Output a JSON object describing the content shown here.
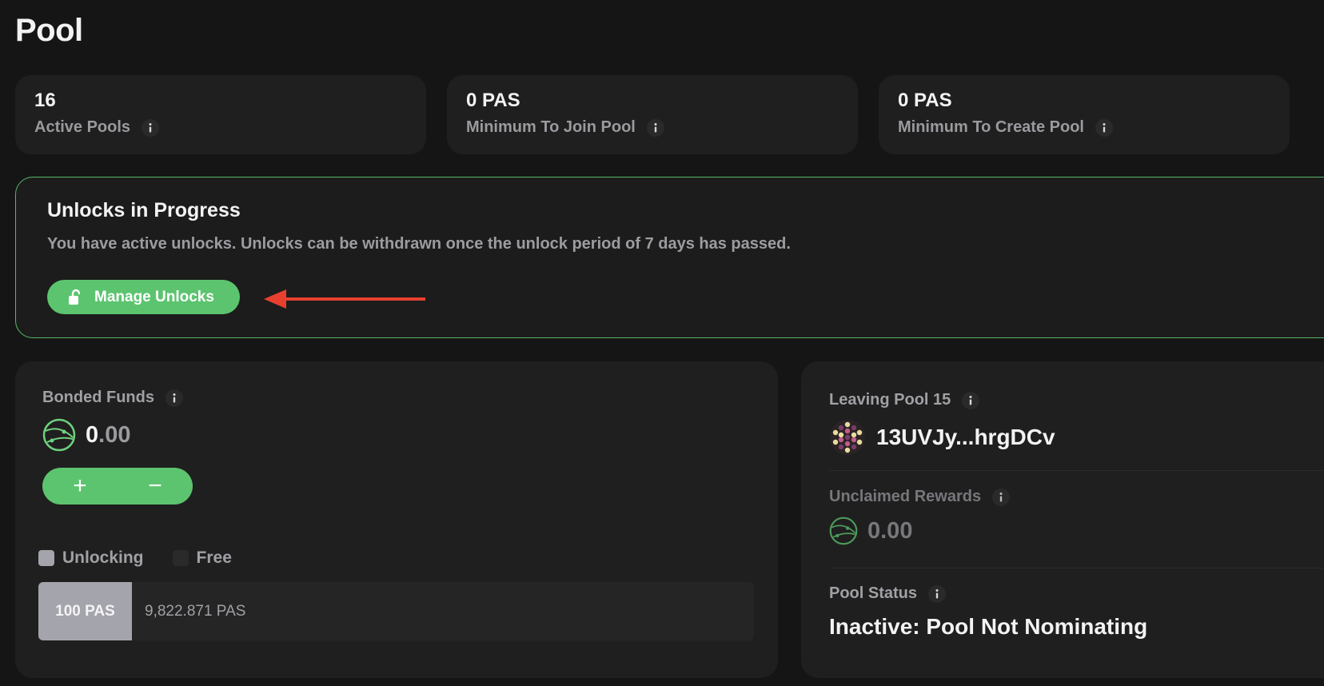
{
  "page": {
    "title": "Pool"
  },
  "stats": [
    {
      "value": "16",
      "label": "Active Pools"
    },
    {
      "value": "0 PAS",
      "label": "Minimum To Join Pool"
    },
    {
      "value": "0 PAS",
      "label": "Minimum To Create Pool"
    }
  ],
  "unlocks": {
    "title": "Unlocks in Progress",
    "description": "You have active unlocks. Unlocks can be withdrawn once the unlock period of 7 days has passed.",
    "button_label": "Manage Unlocks"
  },
  "bonded": {
    "label": "Bonded Funds",
    "amount_int": "0",
    "amount_dec": ".00",
    "add_symbol": "+",
    "remove_symbol": "−",
    "legend": [
      {
        "label": "Unlocking",
        "color": "#a4a4ad"
      },
      {
        "label": "Free",
        "color": "#2a2a2a"
      }
    ],
    "unlocking_value": "100 PAS",
    "free_value": "9,822.871 PAS"
  },
  "pool": {
    "leaving_label": "Leaving Pool 15",
    "address": "13UVJy...hrgDCv",
    "unclaimed_label": "Unclaimed Rewards",
    "unclaimed_amount": "0.00",
    "status_label": "Pool Status",
    "status_value": "Inactive: Pool Not Nominating"
  },
  "colors": {
    "accent_green": "#5cc46f",
    "card_background": "#1f1f1f",
    "arrow_red": "#e8402f"
  },
  "icons": [
    "info-icon",
    "lock-open-icon",
    "token-icon",
    "pool-avatar-icon",
    "arrow-icon"
  ]
}
